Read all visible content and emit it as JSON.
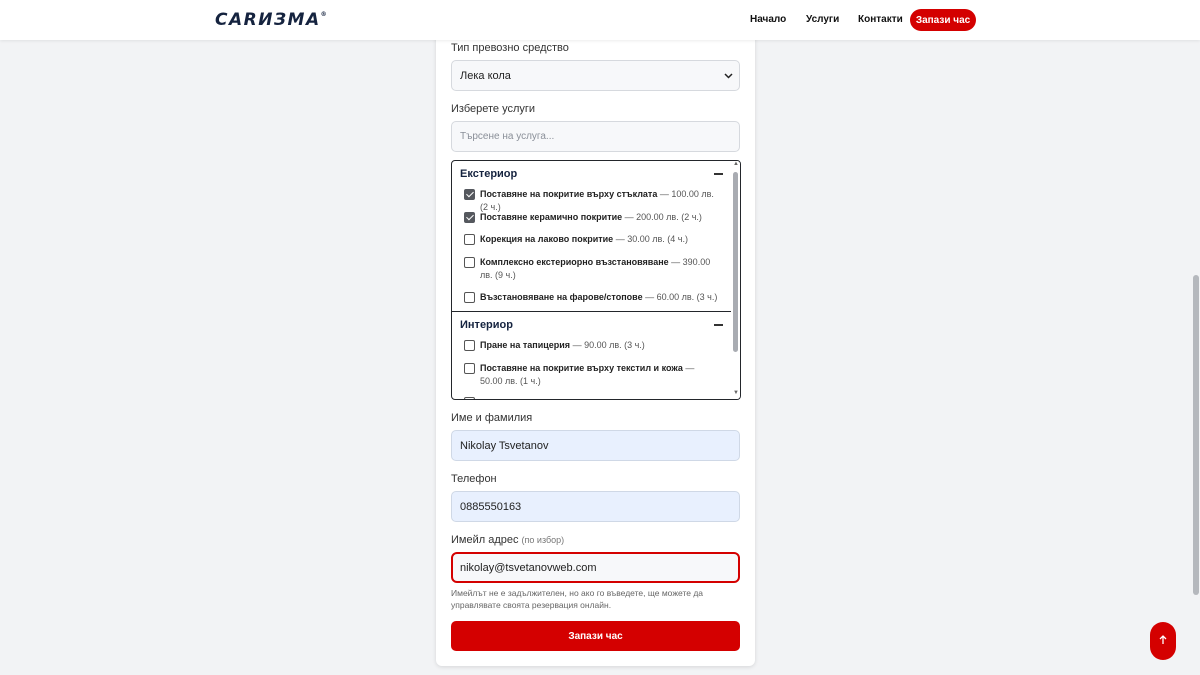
{
  "header": {
    "logo": "CARИЗМА",
    "logo_mark": "®",
    "nav": [
      "Начало",
      "Услуги",
      "Контакти"
    ],
    "cta_label": "Запази час"
  },
  "form": {
    "vehicle_label": "Тип превозно средство",
    "vehicle_value": "Лека кола",
    "services_label": "Изберете услуги",
    "search_placeholder": "Търсене на услуга...",
    "categories": [
      {
        "name": "Екстериор",
        "items": [
          {
            "name": "Поставяне на покритие върху стъклата",
            "price": " — 100.00 лв. (2 ч.)",
            "checked": true
          },
          {
            "name": "Поставяне керамично покритие",
            "price": " — 200.00 лв. (2 ч.)",
            "checked": true
          },
          {
            "name": "Корекция на лаково покритие",
            "price": " — 30.00 лв. (4 ч.)",
            "checked": false
          },
          {
            "name": "Комплексно екстериорно възстановяване",
            "price": " — 390.00 лв. (9 ч.)",
            "checked": false
          },
          {
            "name": "Възстановяване на фарове/стопове",
            "price": " — 60.00 лв. (3 ч.)",
            "checked": false
          }
        ]
      },
      {
        "name": "Интериор",
        "items": [
          {
            "name": "Пране на тапицерия",
            "price": " — 90.00 лв. (3 ч.)",
            "checked": false
          },
          {
            "name": "Поставяне на покритие върху текстил и кожа",
            "price": " — 50.00 лв. (1 ч.)",
            "checked": false
          }
        ]
      }
    ],
    "name_label": "Име и фамилия",
    "name_value": "Nikolay Tsvetanov",
    "phone_label": "Телефон",
    "phone_value": "0885550163",
    "email_label": "Имейл адрес",
    "email_optional": "(по избор)",
    "email_value": "nikolay@tsvetanovweb.com",
    "email_hint": "Имейлът не е задължителен, но ако го въведете, ще можете да управлявате своята резервация онлайн.",
    "submit_label": "Запази час"
  },
  "scroll_top_icon": "arrow-up-icon",
  "colors": {
    "brand_red": "#d40000",
    "brand_navy": "#15233f",
    "page_bg": "#f2f3f5"
  }
}
